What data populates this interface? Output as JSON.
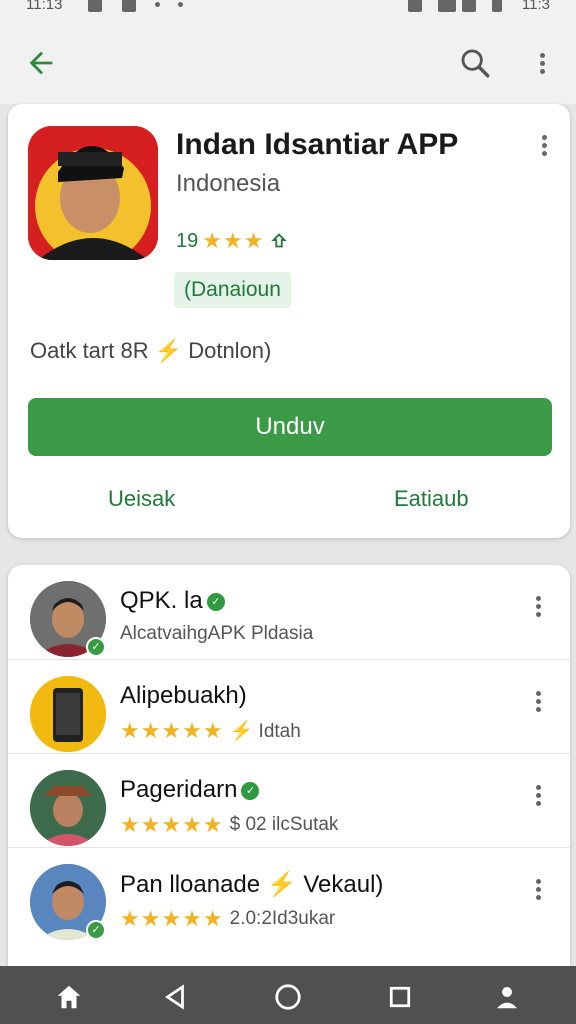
{
  "status_bar": {
    "time": "11:13",
    "right_time": "11:3"
  },
  "app_bar": {
    "back_icon": "arrow-left-icon",
    "search_icon": "search-icon",
    "more_icon": "more-vertical-icon"
  },
  "app": {
    "title": "Indan Idsantiar APP",
    "developer": "Indonesia",
    "rating": "19",
    "stars": "★★★",
    "chip": "(Danaioun",
    "info": "Oatk tart 8R ⚡ Dotnlon)",
    "install_label": "Unduv",
    "left_action": "Ueisak",
    "right_action": "Eatiaub"
  },
  "list": [
    {
      "title": "QPK. la",
      "subtitle": "AlcatvaihgAPK Pldasia",
      "stars": "",
      "verified": true
    },
    {
      "title": "Alipebuakh)",
      "subtitle": "⚡ Idtah",
      "stars": "★★★★★",
      "verified": false
    },
    {
      "title": "Pageridarn",
      "subtitle": "$ 02 ilcSutak",
      "stars": "★★★★★",
      "verified": true
    },
    {
      "title": "Pan lloanade ⚡ Vekaul)",
      "subtitle": "2.0:2Id3ukar",
      "stars": "★★★★★",
      "verified": true
    }
  ],
  "colors": {
    "accent": "#3a9a45",
    "green_text": "#1f7a3a",
    "star": "#f2b322"
  }
}
